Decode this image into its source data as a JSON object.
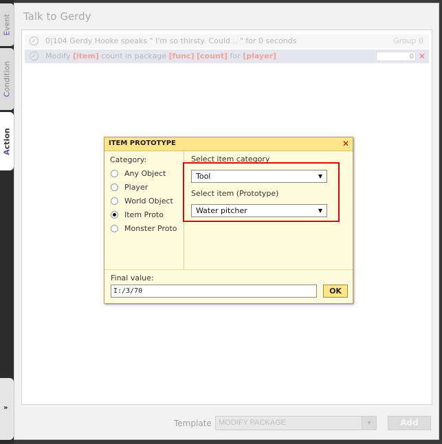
{
  "tabs": [
    {
      "label": "Event"
    },
    {
      "label": "Condition"
    },
    {
      "label": "Action",
      "active": true
    }
  ],
  "expand_glyph": "»",
  "panel": {
    "title": "Talk to Gerdy"
  },
  "rows": [
    {
      "check": "✓",
      "text": "0|104 Gerdy Hooke speaks \" I'm so thirsty. Could .. \" for 0 seconds",
      "group": "Group 0"
    },
    {
      "check": "✓",
      "prefix": "Modify",
      "token_item": "[item]",
      "mid1": "count in package",
      "token_func": "[func]",
      "token_count": "[count]",
      "mid2": "for",
      "token_player": "[player]",
      "value": "0",
      "delete": "✕"
    }
  ],
  "template": {
    "label": "Template :",
    "selected": "MODIFY PACKAGE",
    "caret": "▼",
    "add_label": "Add"
  },
  "dialog": {
    "title": "ITEM PROTOTYPE",
    "close": "✕",
    "category_label": "Category:",
    "categories": [
      {
        "label": "Any Object",
        "checked": false
      },
      {
        "label": "Player",
        "checked": false
      },
      {
        "label": "World Object",
        "checked": false
      },
      {
        "label": "Item Proto",
        "checked": true
      },
      {
        "label": "Monster Proto",
        "checked": false
      }
    ],
    "select_category_label": "Select item category",
    "category_value": "Tool",
    "select_item_label": "Select item (Prototype)",
    "item_value": "Water pitcher",
    "caret": "▼",
    "final_label": "Final value:",
    "final_value": "I:/3/70",
    "ok_label": "OK"
  },
  "colors": {
    "dialog_header": "#ffe58a",
    "dialog_bg": "#fffcde",
    "highlight": "#e00000",
    "token": "#f2a0a0"
  }
}
